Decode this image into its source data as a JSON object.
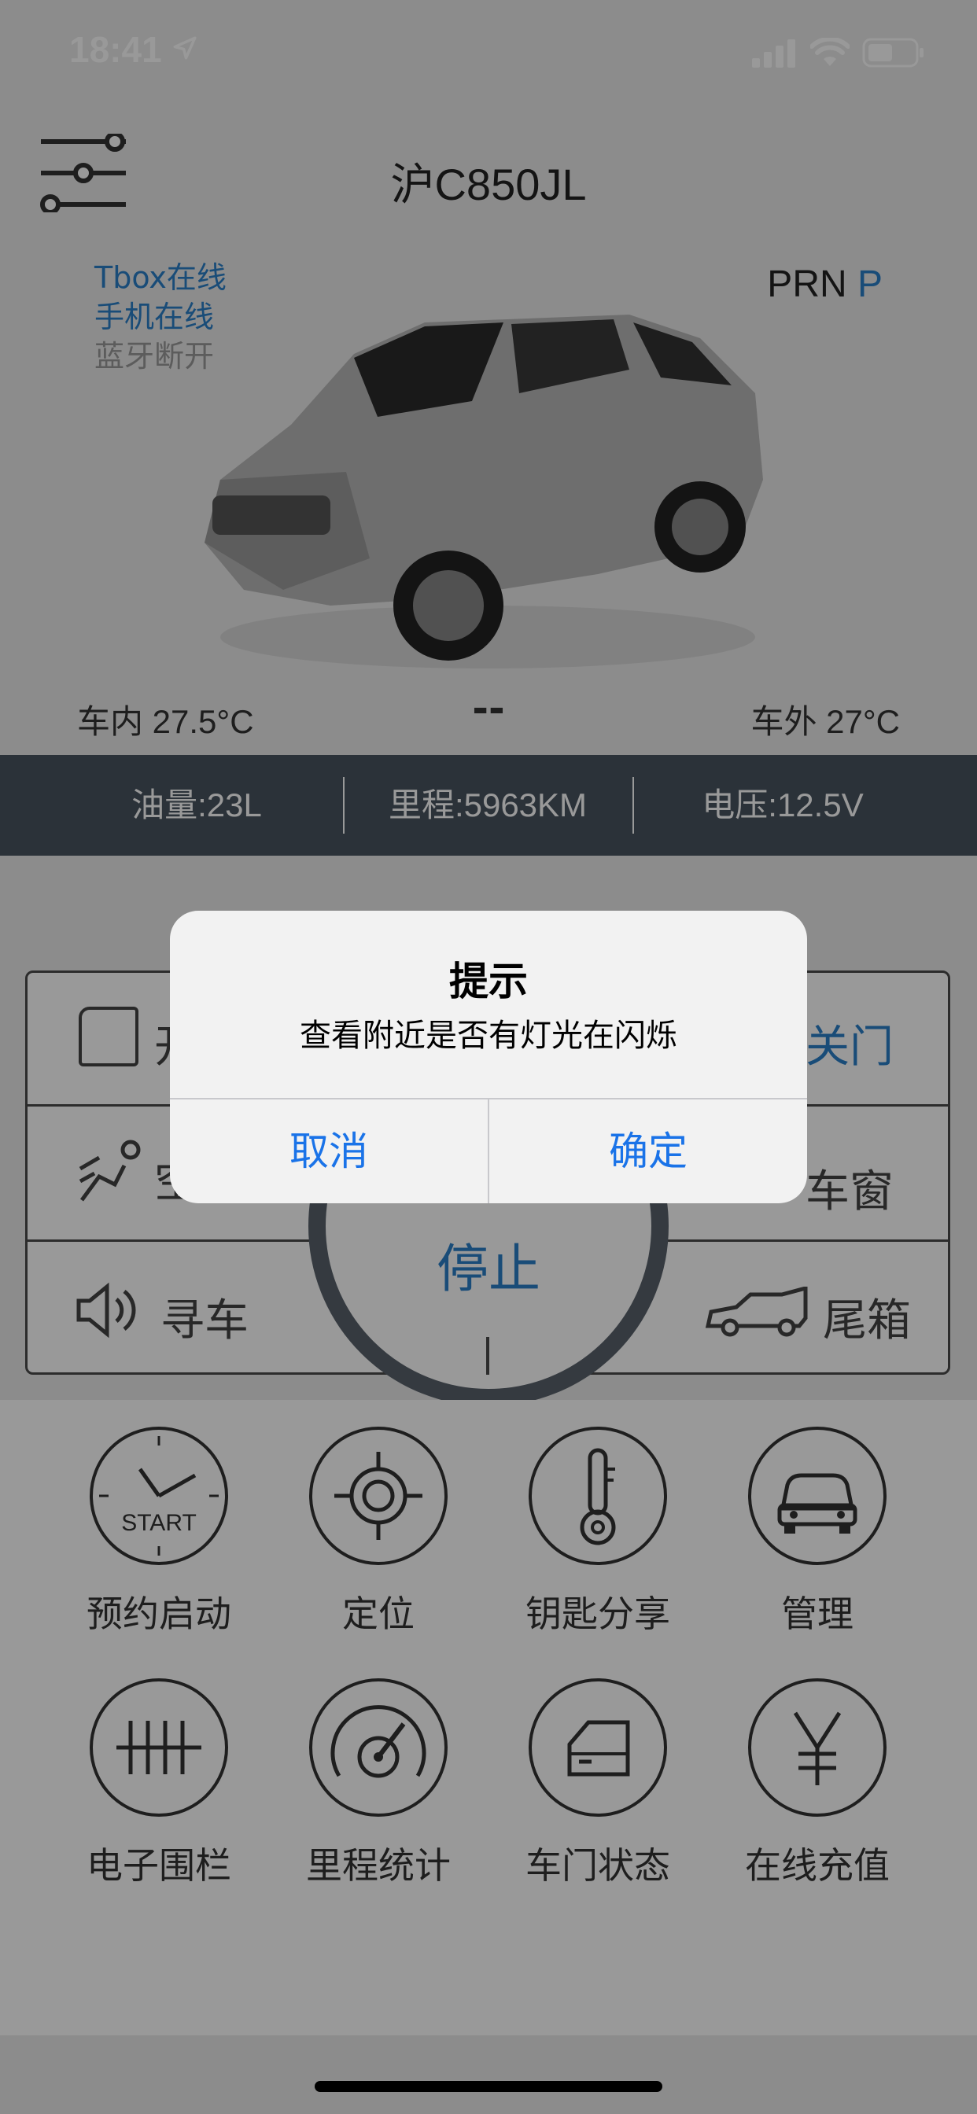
{
  "status_bar": {
    "time": "18:41"
  },
  "header": {
    "plate": "沪C850JL"
  },
  "connectivity": {
    "tbox": "Tbox在线",
    "phone": "手机在线",
    "bluetooth": "蓝牙断开"
  },
  "gear": {
    "label": "PRN",
    "current": "P"
  },
  "temps": {
    "inside": "车内 27.5°C",
    "middle": "--",
    "outside": "车外 27°C"
  },
  "info_strip": {
    "fuel": "油量:23L",
    "mileage": "里程:5963KM",
    "voltage": "电压:12.5V"
  },
  "controls": {
    "open_door_partial": "开",
    "close_door": "关门",
    "ac_partial": "空",
    "window": "车窗",
    "find_car": "寻车",
    "trunk": "尾箱",
    "stop": "停止"
  },
  "grid": [
    {
      "label": "预约启动",
      "icon": "start-timer-icon"
    },
    {
      "label": "定位",
      "icon": "location-target-icon"
    },
    {
      "label": "钥匙分享",
      "icon": "key-icon"
    },
    {
      "label": "管理",
      "icon": "car-front-icon"
    },
    {
      "label": "电子围栏",
      "icon": "fence-icon"
    },
    {
      "label": "里程统计",
      "icon": "odometer-icon"
    },
    {
      "label": "车门状态",
      "icon": "door-icon"
    },
    {
      "label": "在线充值",
      "icon": "yen-icon"
    }
  ],
  "grid_start_text": "START",
  "dialog": {
    "title": "提示",
    "message": "查看附近是否有灯光在闪烁",
    "cancel": "取消",
    "confirm": "确定"
  }
}
